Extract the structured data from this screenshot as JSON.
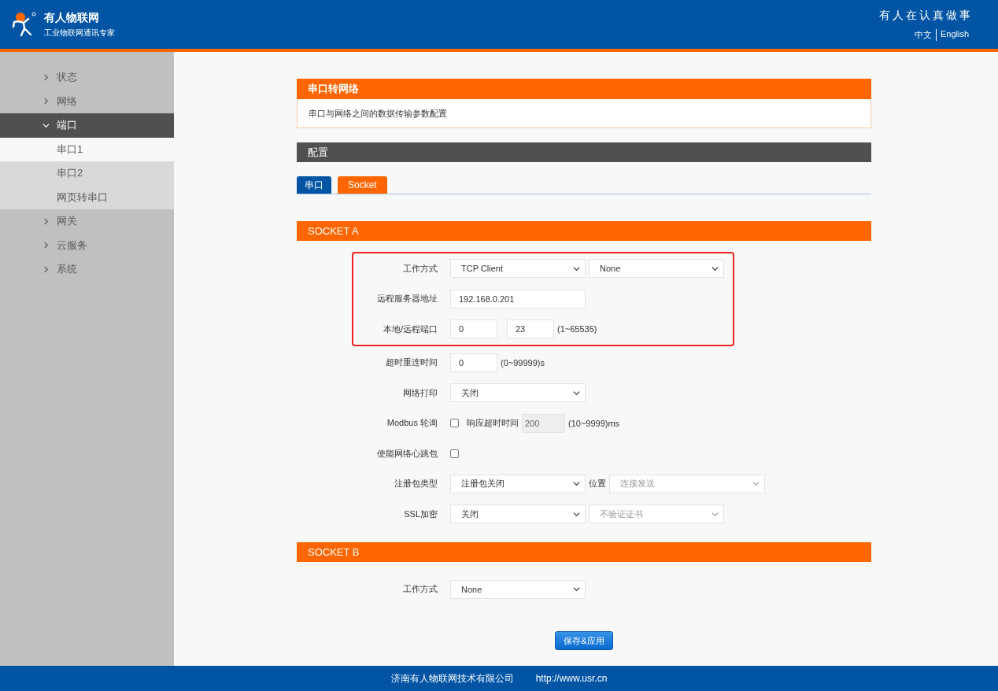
{
  "header": {
    "brand": "有人物联网",
    "tagline": "工业物联网通讯专家",
    "slogan": "有人在认真做事",
    "languages": [
      {
        "label": "中文"
      },
      {
        "label": "English"
      }
    ]
  },
  "sidebar": {
    "items": [
      {
        "label": "状态",
        "expanded": false
      },
      {
        "label": "网络",
        "expanded": false
      },
      {
        "label": "端口",
        "expanded": true,
        "children": [
          {
            "label": "串口1",
            "selected": true
          },
          {
            "label": "串口2",
            "selected": false
          },
          {
            "label": "网页转串口",
            "selected": false
          }
        ]
      },
      {
        "label": "网关",
        "expanded": false
      },
      {
        "label": "云服务",
        "expanded": false
      },
      {
        "label": "系统",
        "expanded": false
      }
    ]
  },
  "intro": {
    "title": "串口转网络",
    "description": "串口与网络之间的数据传输参数配置"
  },
  "config": {
    "title": "配置",
    "tabs": [
      {
        "label": "串口",
        "selected": false
      },
      {
        "label": "Socket",
        "selected": true
      }
    ]
  },
  "socket_a": {
    "title": "SOCKET A",
    "highlighted_rows": [
      {
        "label": "工作方式",
        "controls": [
          {
            "kind": "select",
            "value": "TCP Client",
            "disabled": false
          },
          {
            "kind": "select",
            "value": "None",
            "disabled": false
          }
        ]
      },
      {
        "label": "远程服务器地址",
        "controls": [
          {
            "kind": "input",
            "value": "192.168.0.201",
            "disabled": false
          }
        ]
      },
      {
        "label": "本地/远程端口",
        "controls": [
          {
            "kind": "input",
            "value": "0",
            "disabled": false
          },
          {
            "kind": "input",
            "value": "23",
            "disabled": false
          },
          {
            "kind": "text",
            "value": "(1~65535)"
          }
        ]
      }
    ],
    "rows": [
      {
        "label": "超时重连时间",
        "controls": [
          {
            "kind": "input",
            "value": "0",
            "disabled": false
          },
          {
            "kind": "text",
            "value": "(0~99999)s"
          }
        ]
      },
      {
        "label": "网络打印",
        "controls": [
          {
            "kind": "select",
            "value": "关闭",
            "disabled": false
          }
        ]
      },
      {
        "label": "Modbus 轮询",
        "controls": [
          {
            "kind": "checkbox",
            "checked": false
          },
          {
            "kind": "text",
            "value": "响应超时时间"
          },
          {
            "kind": "input",
            "value": "200",
            "disabled": true
          },
          {
            "kind": "text",
            "value": "(10~9999)ms"
          }
        ]
      },
      {
        "label": "使能网络心跳包",
        "controls": [
          {
            "kind": "checkbox",
            "checked": false
          }
        ]
      },
      {
        "label": "注册包类型",
        "controls": [
          {
            "kind": "select",
            "value": "注册包关闭",
            "disabled": false
          },
          {
            "kind": "text",
            "value": "位置"
          },
          {
            "kind": "select",
            "value": "连接发送",
            "disabled": true
          }
        ]
      },
      {
        "label": "SSL加密",
        "controls": [
          {
            "kind": "select",
            "value": "关闭",
            "disabled": false
          },
          {
            "kind": "select",
            "value": "不验证证书",
            "disabled": true
          }
        ]
      }
    ]
  },
  "socket_b": {
    "title": "SOCKET B",
    "rows": [
      {
        "label": "工作方式",
        "controls": [
          {
            "kind": "select",
            "value": "None",
            "disabled": false
          }
        ]
      }
    ]
  },
  "save_button": "保存&应用",
  "footer": {
    "company": "济南有人物联网技术有限公司",
    "url": "http://www.usr.cn"
  }
}
